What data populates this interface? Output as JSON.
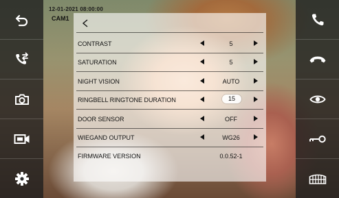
{
  "overlay": {
    "timestamp": "12-01-2021  08:00:00",
    "camera_name": "CAM1"
  },
  "left_toolbar": [
    {
      "icon": "return-icon"
    },
    {
      "icon": "call-transfer-icon"
    },
    {
      "icon": "camera-icon"
    },
    {
      "icon": "video-record-icon"
    },
    {
      "icon": "gear-icon"
    }
  ],
  "right_toolbar": [
    {
      "icon": "phone-answer-icon"
    },
    {
      "icon": "phone-hangup-icon"
    },
    {
      "icon": "eye-icon"
    },
    {
      "icon": "key-icon"
    },
    {
      "icon": "gate-icon"
    }
  ],
  "menu": {
    "back_glyph": "<",
    "left_arrow": "◀",
    "right_arrow": "▶",
    "settings": [
      {
        "label": "CONTRAST",
        "value": "5",
        "has_arrows": true,
        "selected": false
      },
      {
        "label": "SATURATION",
        "value": "5",
        "has_arrows": true,
        "selected": false
      },
      {
        "label": "NIGHT VISION",
        "value": "AUTO",
        "has_arrows": true,
        "selected": false
      },
      {
        "label": "RINGBELL RINGTONE DURATION",
        "value": "15",
        "has_arrows": true,
        "selected": true
      },
      {
        "label": "DOOR SENSOR",
        "value": "OFF",
        "has_arrows": true,
        "selected": false
      },
      {
        "label": "WIEGAND OUTPUT",
        "value": "WG26",
        "has_arrows": true,
        "selected": false
      },
      {
        "label": "FIRMWARE VERSION",
        "value": "0.0.52-1",
        "has_arrows": false,
        "selected": false
      }
    ]
  },
  "colors": {
    "toolbar_bg": "#1e1e1e",
    "icon": "#ffffff",
    "menu_text": "#111111"
  }
}
